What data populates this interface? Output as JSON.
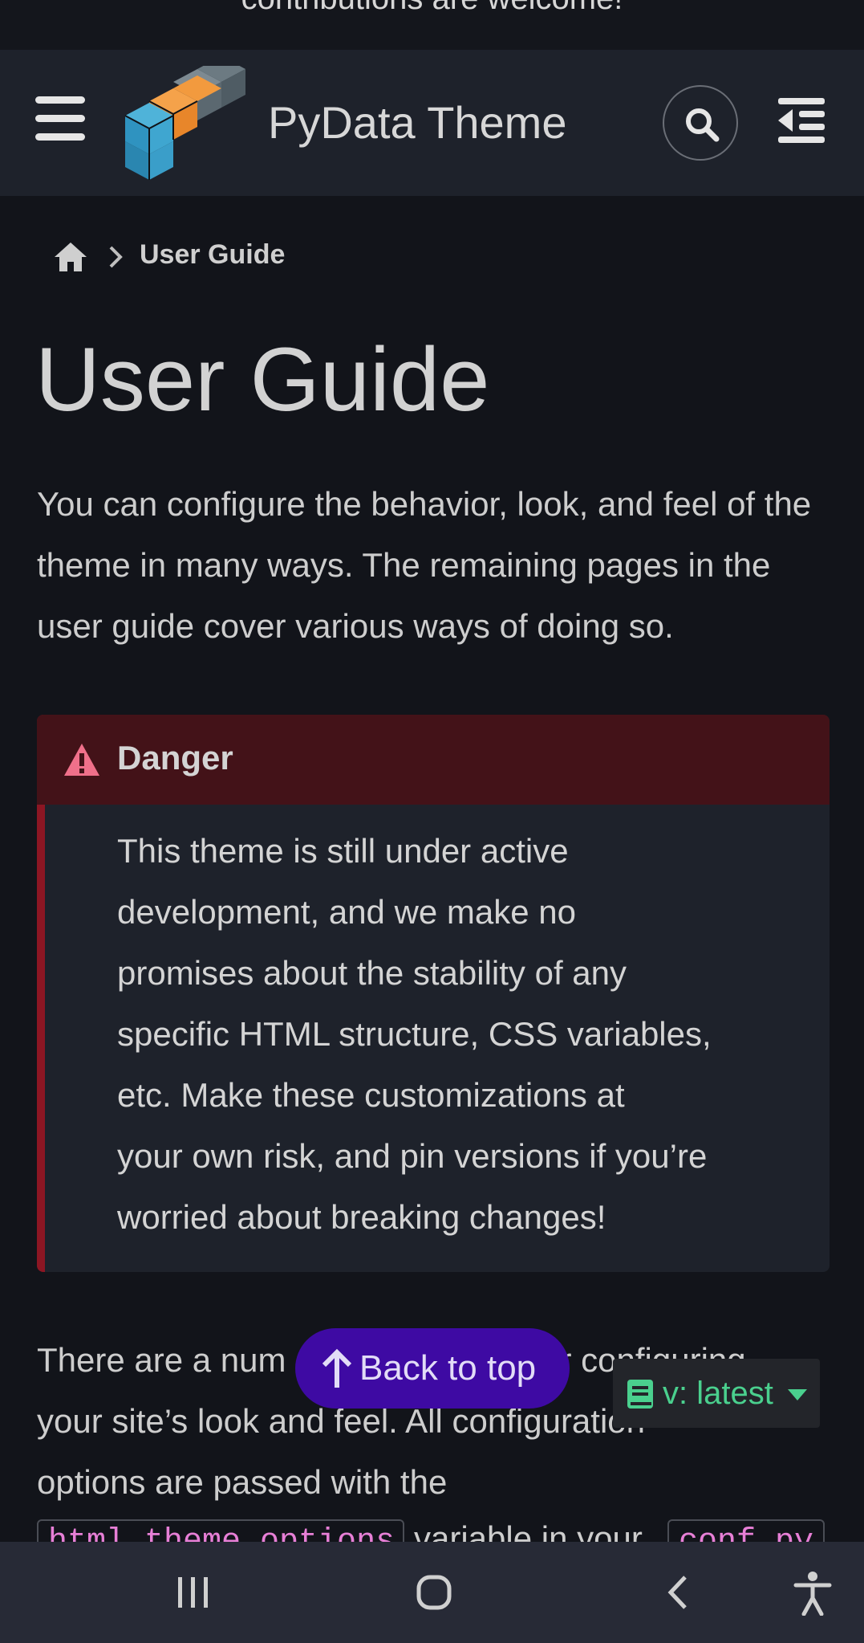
{
  "announcement": {
    "text": "contributions are welcome!"
  },
  "navbar": {
    "brand": "PyData Theme",
    "menu_icon": "hamburger-menu-icon",
    "search_icon": "search-icon",
    "toc_icon": "toc-outdent-icon"
  },
  "breadcrumb": {
    "home_icon": "home-icon",
    "current": "User Guide"
  },
  "page": {
    "title": "User Guide",
    "intro": "You can configure the behavior, look, and feel of the theme in many ways. The remaining pages in the user guide cover various ways of doing so."
  },
  "admonition": {
    "title": "Danger",
    "icon": "warning-triangle-icon",
    "body_lines": [
      "This theme is still under active",
      "development, and we make no",
      "promises about the stability of any",
      "specific HTML structure, CSS variables,",
      "etc. Make these customizations at",
      "your own risk, and pin versions if you’re",
      "worried about breaking changes!"
    ]
  },
  "para2": {
    "line1_start": "There are a num",
    "line1_end": "r configuring",
    "line2": "your site’s look and feel. All configuration",
    "line3": "options are passed with the",
    "code1": "html_theme_options",
    "line4_mid": "variable in your",
    "code2": "conf.py"
  },
  "back_to_top": {
    "label": "Back to top",
    "icon": "arrow-up-icon"
  },
  "version_switcher": {
    "label": "v: latest",
    "icon": "book-icon"
  },
  "system_nav": {
    "recents_icon": "recents-icon",
    "home_icon": "home-circle-icon",
    "back_icon": "back-chevron-icon",
    "accessibility_icon": "accessibility-icon"
  },
  "colors": {
    "background": "#12141a",
    "navbar": "#1e222b",
    "danger_header": "#431218",
    "danger_bar": "#8c1623",
    "back_to_top": "#3e0aa3",
    "version_text": "#4ad08e",
    "code_text": "#e77fd6"
  }
}
